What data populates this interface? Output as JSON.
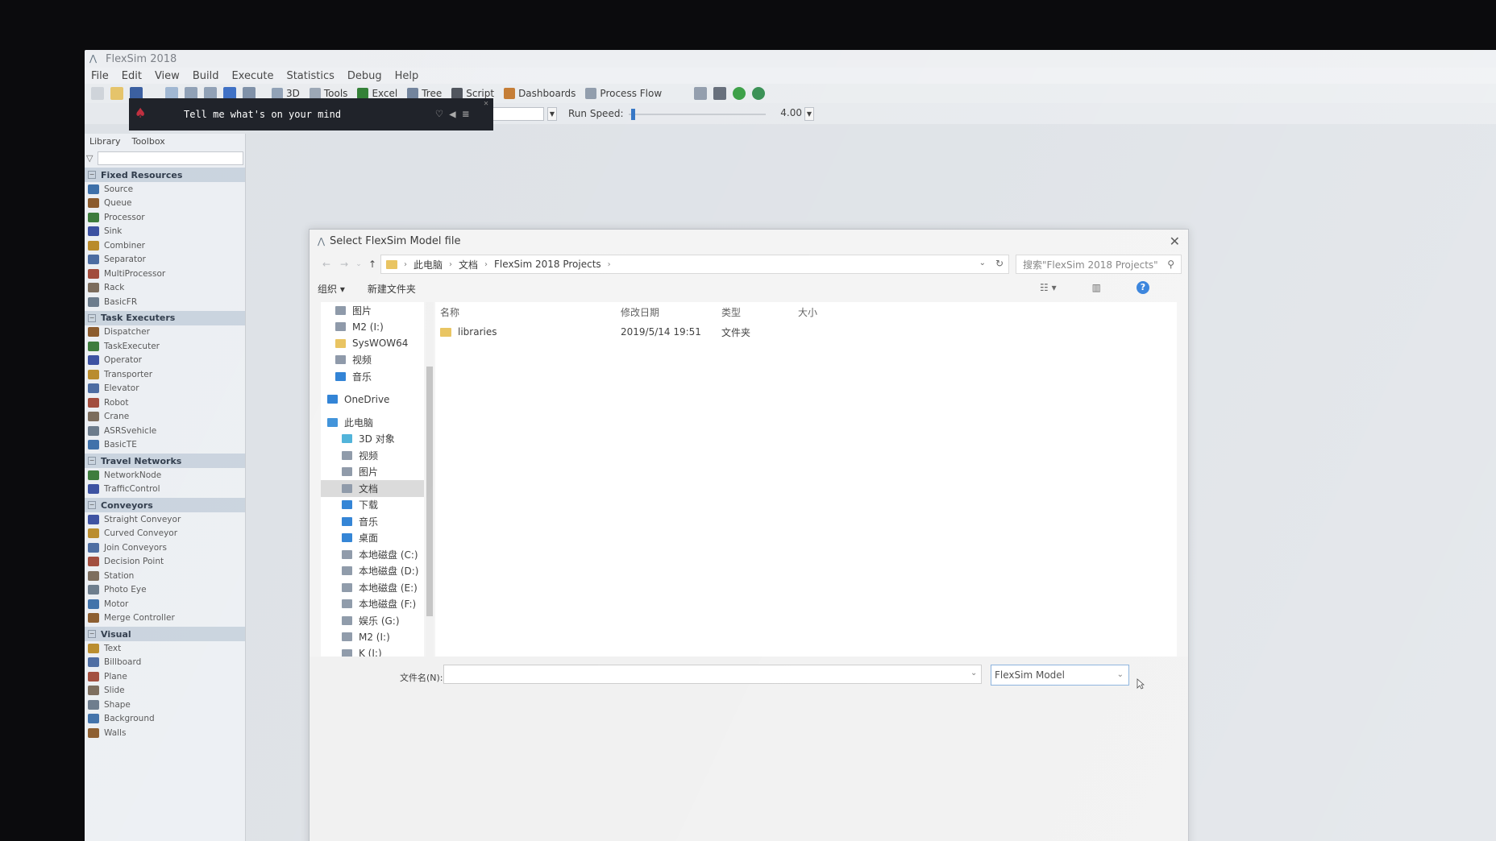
{
  "app": {
    "title": "FlexSim 2018",
    "menu": [
      "File",
      "Edit",
      "View",
      "Build",
      "Execute",
      "Statistics",
      "Debug",
      "Help"
    ],
    "toolbar": [
      "3D",
      "Tools",
      "Excel",
      "Tree",
      "Script",
      "Dashboards",
      "Process Flow"
    ],
    "run_speed_label": "Run Speed:",
    "run_speed_value": "4.00",
    "run_speed_fraction": 0.02
  },
  "notification": {
    "text": "Tell me what's on your mind"
  },
  "library": {
    "tabs": [
      "Library",
      "Toolbox"
    ],
    "sections": [
      {
        "title": "Fixed Resources",
        "items": [
          "Source",
          "Queue",
          "Processor",
          "Sink",
          "Combiner",
          "Separator",
          "MultiProcessor",
          "Rack",
          "BasicFR"
        ]
      },
      {
        "title": "Task Executers",
        "items": [
          "Dispatcher",
          "TaskExecuter",
          "Operator",
          "Transporter",
          "Elevator",
          "Robot",
          "Crane",
          "ASRSvehicle",
          "BasicTE"
        ]
      },
      {
        "title": "Travel Networks",
        "items": [
          "NetworkNode",
          "TrafficControl"
        ]
      },
      {
        "title": "Conveyors",
        "items": [
          "Straight Conveyor",
          "Curved Conveyor",
          "Join Conveyors",
          "Decision Point",
          "Station",
          "Photo Eye",
          "Motor",
          "Merge Controller"
        ]
      },
      {
        "title": "Visual",
        "items": [
          "Text",
          "Billboard",
          "Plane",
          "Slide",
          "Shape",
          "Background",
          "Walls"
        ]
      }
    ]
  },
  "dialog": {
    "title": "Select FlexSim Model file",
    "breadcrumb": [
      "此电脑",
      "文档",
      "FlexSim 2018 Projects"
    ],
    "search_placeholder": "搜索\"FlexSim 2018 Projects\"",
    "commands": [
      "组织 ▾",
      "新建文件夹"
    ],
    "nav": [
      "图片",
      "M2 (I:)",
      "SysWOW64",
      "视频",
      "音乐",
      "OneDrive",
      "此电脑",
      "3D 对象",
      "视频",
      "图片",
      "文档",
      "下载",
      "音乐",
      "桌面",
      "本地磁盘 (C:)",
      "本地磁盘 (D:)",
      "本地磁盘 (E:)",
      "本地磁盘 (F:)",
      "娱乐 (G:)",
      "M2 (I:)",
      "K (J:)"
    ],
    "selected_nav": "文档",
    "columns": [
      "名称",
      "修改日期",
      "类型",
      "大小"
    ],
    "files": [
      {
        "name": "libraries",
        "modified": "2019/5/14 19:51",
        "type": "文件夹",
        "size": ""
      }
    ],
    "filename_label": "文件名(N):",
    "filename_value": "",
    "filetype_value": "FlexSim Model"
  }
}
